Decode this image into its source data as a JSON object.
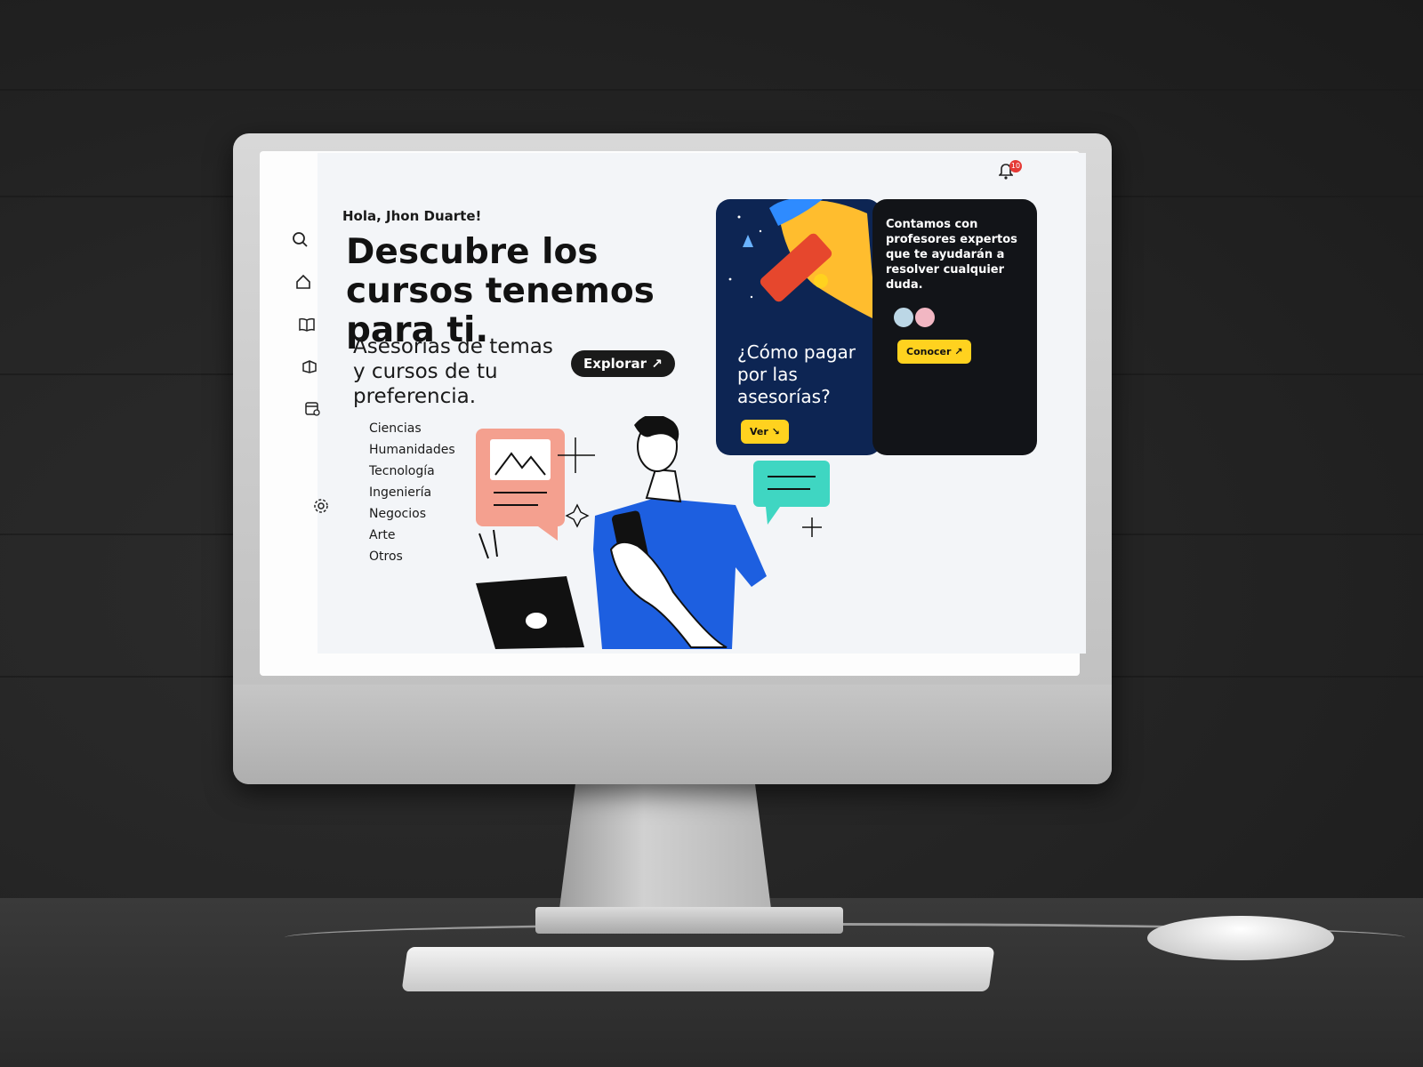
{
  "header": {
    "notification_count": "10"
  },
  "hero": {
    "greeting": "Hola, Jhon Duarte!",
    "title": "Descubre los cursos tenemos para ti.",
    "subtitle": "Asesorías de temas y cursos de tu preferencia.",
    "explore_label": "Explorar ↗"
  },
  "topics": [
    "Ciencias",
    "Humanidades",
    "Tecnología",
    "Ingeniería",
    "Negocios",
    "Arte",
    "Otros"
  ],
  "cards": {
    "payment": {
      "title": "¿Cómo pagar por las asesorías?",
      "button_label": "Ver ↘"
    },
    "teachers": {
      "text": "Contamos con profesores expertos que te ayudarán a resolver cualquier duda.",
      "button_label": "Conocer ↗"
    }
  },
  "colors": {
    "accent_yellow": "#ffd21f",
    "card_blue": "#0d2553",
    "card_dark": "#121418",
    "illustration_blue": "#1d5fe0",
    "illustration_pink": "#f4a08f",
    "illustration_teal": "#3fd6c2"
  },
  "icons": [
    "search-icon",
    "home-icon",
    "book-icon",
    "open-book-icon",
    "calendar-icon",
    "settings-icon",
    "bell-icon"
  ]
}
